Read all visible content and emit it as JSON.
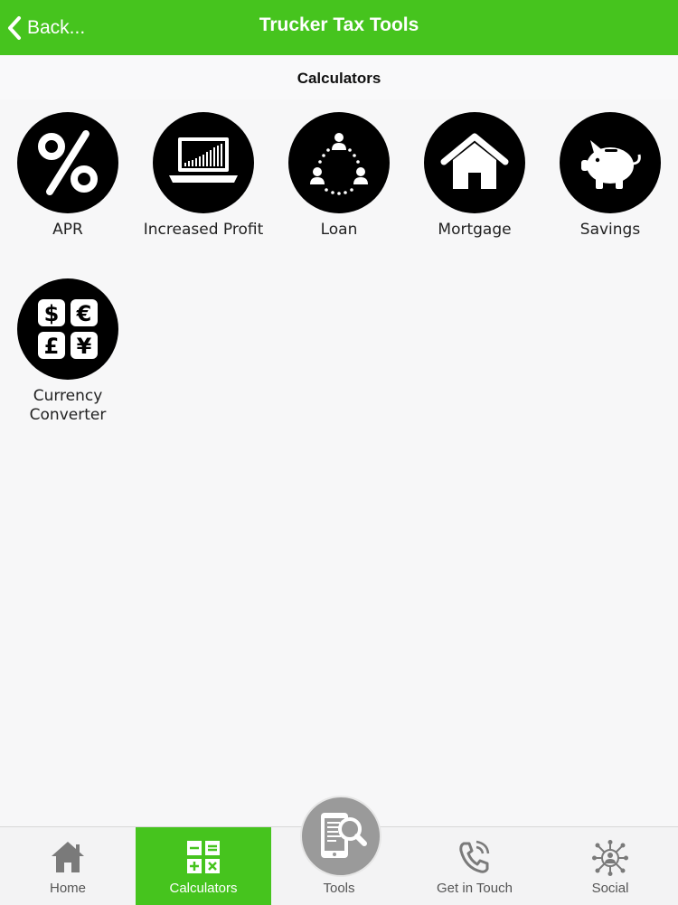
{
  "header": {
    "back_label": "Back...",
    "title": "Trucker Tax Tools"
  },
  "subheader": {
    "title": "Calculators"
  },
  "calculators": [
    {
      "label": "APR",
      "icon": "percent-icon"
    },
    {
      "label": "Increased Profit",
      "icon": "laptop-chart-icon"
    },
    {
      "label": "Loan",
      "icon": "people-network-icon"
    },
    {
      "label": "Mortgage",
      "icon": "house-icon"
    },
    {
      "label": "Savings",
      "icon": "piggy-bank-icon"
    },
    {
      "label_line1": "Currency",
      "label_line2": "Converter",
      "icon": "currency-icon"
    }
  ],
  "tabs": [
    {
      "label": "Home",
      "icon": "home-icon",
      "active": false
    },
    {
      "label": "Calculators",
      "icon": "calculator-icon",
      "active": true
    },
    {
      "label": "Tools",
      "icon": "tablet-search-icon",
      "active": false
    },
    {
      "label": "Get in Touch",
      "icon": "phone-icon",
      "active": false
    },
    {
      "label": "Social",
      "icon": "social-network-icon",
      "active": false
    }
  ],
  "colors": {
    "brand_green": "#46c41e",
    "icon_circle": "#000000",
    "tab_icon_gray": "#7a7a7a"
  }
}
